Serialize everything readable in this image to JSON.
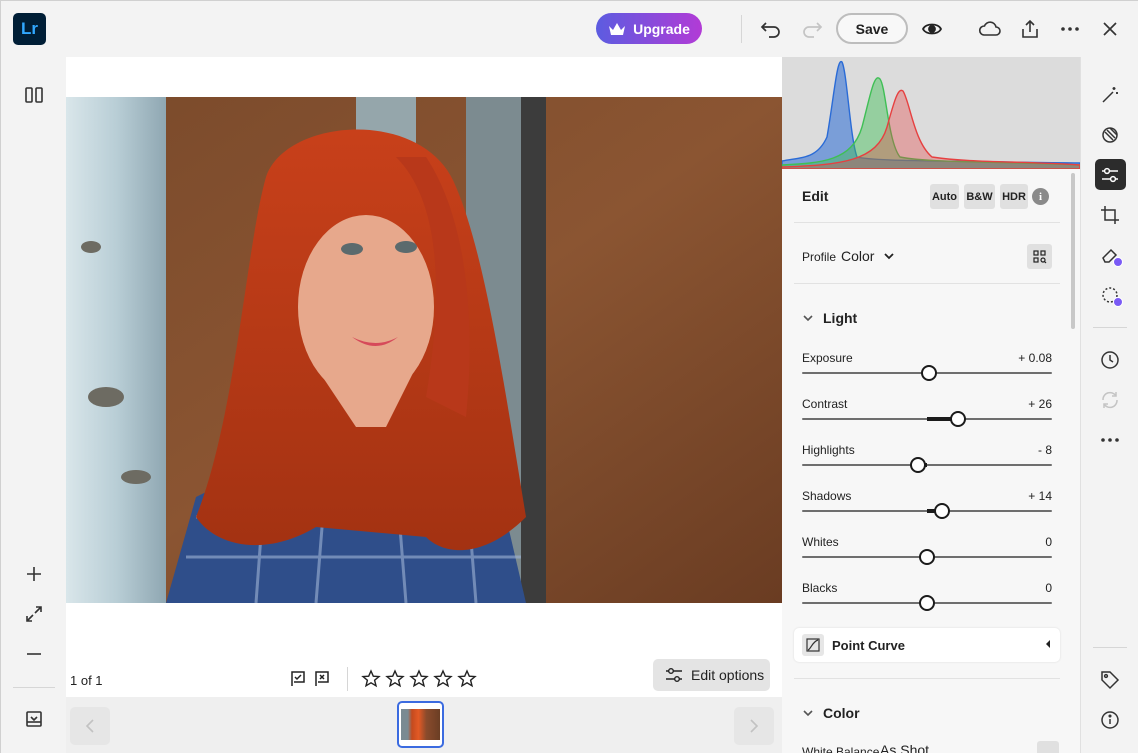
{
  "app": {
    "logo": "Lr"
  },
  "topbar": {
    "upgrade_label": "Upgrade",
    "save_label": "Save",
    "icons": [
      "undo-icon",
      "redo-icon",
      "preview-eye-icon",
      "cloud-icon",
      "share-icon",
      "more-icon",
      "close-icon"
    ]
  },
  "leftrail": {
    "icons": [
      "compare-view-icon",
      "zoom-in-icon",
      "fit-screen-icon",
      "zoom-out-icon",
      "filmstrip-toggle-icon"
    ]
  },
  "canvas": {
    "count_label": "1 of 1",
    "flags": [
      "flag-pick-icon",
      "flag-reject-icon"
    ],
    "stars": 0,
    "edit_options_label": "Edit options"
  },
  "panel": {
    "title": "Edit",
    "auto_label": "Auto",
    "bw_label": "B&W",
    "hdr_label": "HDR",
    "info_label": "i",
    "profile_label": "Profile",
    "profile_value": "Color",
    "light_section": "Light",
    "sliders": [
      {
        "label": "Exposure",
        "value": "+ 0.08",
        "pos": 0.508
      },
      {
        "label": "Contrast",
        "value": "+ 26",
        "pos": 0.624
      },
      {
        "label": "Highlights",
        "value": "- 8",
        "pos": 0.464
      },
      {
        "label": "Shadows",
        "value": "+ 14",
        "pos": 0.56
      },
      {
        "label": "Whites",
        "value": "0",
        "pos": 0.5
      },
      {
        "label": "Blacks",
        "value": "0",
        "pos": 0.5
      }
    ],
    "point_curve_label": "Point Curve",
    "color_section": "Color",
    "white_balance_label": "White Balance",
    "white_balance_value": "As Shot"
  },
  "rightrail": {
    "icons": [
      "auto-enhance-wand-icon",
      "presets-icon",
      "edit-sliders-icon",
      "crop-rotate-icon",
      "healing-eraser-icon",
      "masking-icon",
      "history-icon",
      "versions-icon",
      "more-icon",
      "tags-icon",
      "info-icon"
    ]
  },
  "colors": {
    "accent": "#3b6be0",
    "upgrade_start": "#5c5ce0",
    "upgrade_end": "#b23bd6",
    "active_tool": "#2c2c2c"
  }
}
